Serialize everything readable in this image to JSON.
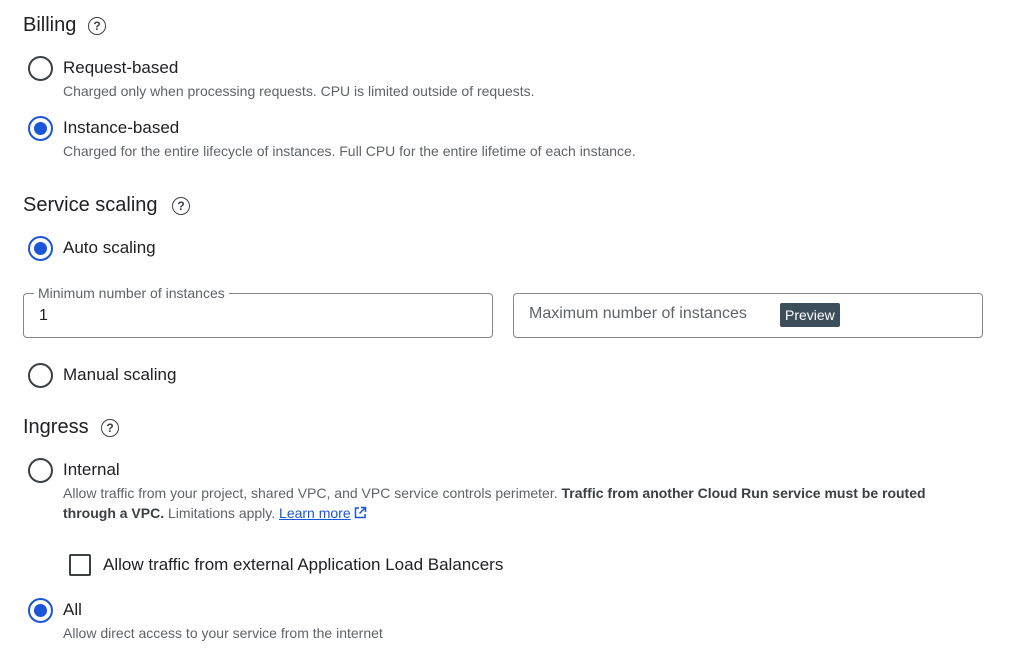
{
  "billing": {
    "title": "Billing",
    "help_icon": "help-circle-icon",
    "options": [
      {
        "label": "Request-based",
        "description": "Charged only when processing requests. CPU is limited outside of requests.",
        "selected": false
      },
      {
        "label": "Instance-based",
        "description": "Charged for the entire lifecycle of instances. Full CPU for the entire lifetime of each instance.",
        "selected": true
      }
    ]
  },
  "scaling": {
    "title": "Service scaling",
    "help_icon": "help-circle-icon",
    "auto_label": "Auto scaling",
    "auto_selected": true,
    "min_instances": {
      "label": "Minimum number of instances",
      "value": "1"
    },
    "max_instances": {
      "placeholder": "Maximum number of instances",
      "badge": "Preview"
    },
    "manual_label": "Manual scaling",
    "manual_selected": false
  },
  "ingress": {
    "title": "Ingress",
    "help_icon": "help-circle-icon",
    "internal": {
      "label": "Internal",
      "selected": false,
      "description_plain": "Allow traffic from your project, shared VPC, and VPC service controls perimeter. ",
      "description_bold": "Traffic from another Cloud Run service must be routed through a VPC.",
      "description_tail": " Limitations apply. ",
      "learn_more": "Learn more",
      "learn_more_icon": "open-in-new-icon"
    },
    "external_lb": {
      "label": "Allow traffic from external Application Load Balancers",
      "checked": false
    },
    "all": {
      "label": "All",
      "description": "Allow direct access to your service from the internet",
      "selected": true
    }
  },
  "colors": {
    "accent": "#1a56d6",
    "text": "#202124",
    "secondary": "#5f6368",
    "badge_bg": "#3c4e5a"
  }
}
